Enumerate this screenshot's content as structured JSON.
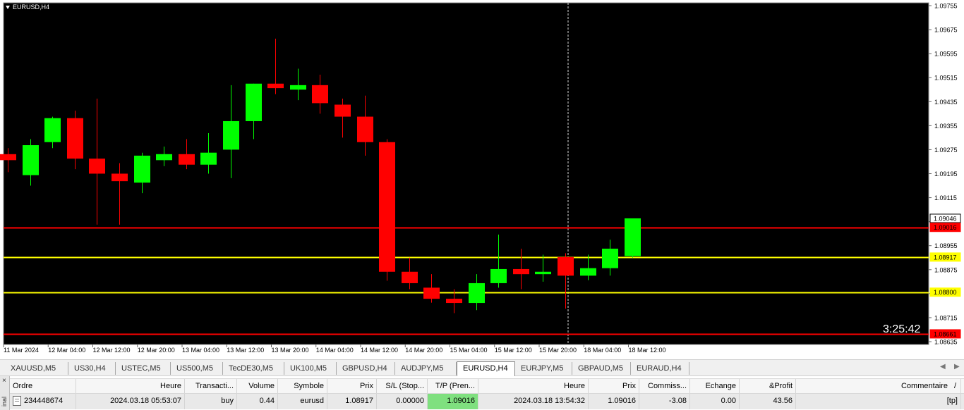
{
  "chart": {
    "symbol_label": "EURUSD,H4",
    "countdown": "3:25:42",
    "price_axis": [
      "1.09755",
      "1.09675",
      "1.09595",
      "1.09515",
      "1.09435",
      "1.09355",
      "1.09275",
      "1.09195",
      "1.09115",
      "1.09035",
      "1.08955",
      "1.08875",
      "1.08795",
      "1.08715",
      "1.08635"
    ],
    "price_tags": [
      {
        "price": "1.09046",
        "style": "current"
      },
      {
        "price": "1.09016",
        "style": "red"
      },
      {
        "price": "1.08917",
        "style": "yellow"
      },
      {
        "price": "1.08800",
        "style": "yellow"
      },
      {
        "price": "1.08661",
        "style": "red"
      }
    ],
    "time_axis": [
      "11 Mar 2024",
      "12 Mar 04:00",
      "12 Mar 12:00",
      "12 Mar 20:00",
      "13 Mar 04:00",
      "13 Mar 12:00",
      "13 Mar 20:00",
      "14 Mar 04:00",
      "14 Mar 12:00",
      "14 Mar 20:00",
      "15 Mar 04:00",
      "15 Mar 12:00",
      "15 Mar 20:00",
      "18 Mar 04:00",
      "18 Mar 12:00"
    ],
    "colors": {
      "background": "#000000",
      "bull": "#00ff00",
      "bear": "#ff0000",
      "tp_line": "#ff0000",
      "entry_line": "#ffff00"
    }
  },
  "chart_data": {
    "type": "candlestick",
    "title": "EURUSD,H4",
    "ylim": [
      1.08635,
      1.09755
    ],
    "horizontal_lines": [
      1.09016,
      1.08917,
      1.088,
      1.08661
    ],
    "candles": [
      {
        "o": 1.0926,
        "h": 1.0928,
        "l": 1.092,
        "c": 1.0924
      },
      {
        "o": 1.0919,
        "h": 1.0931,
        "l": 1.09155,
        "c": 1.0929
      },
      {
        "o": 1.093,
        "h": 1.09385,
        "l": 1.0928,
        "c": 1.0938
      },
      {
        "o": 1.0938,
        "h": 1.09405,
        "l": 1.0921,
        "c": 1.09245
      },
      {
        "o": 1.09245,
        "h": 1.09445,
        "l": 1.09025,
        "c": 1.09195
      },
      {
        "o": 1.09195,
        "h": 1.0923,
        "l": 1.09025,
        "c": 1.0917
      },
      {
        "o": 1.09165,
        "h": 1.09265,
        "l": 1.0913,
        "c": 1.09255
      },
      {
        "o": 1.0924,
        "h": 1.09285,
        "l": 1.0922,
        "c": 1.0926
      },
      {
        "o": 1.0926,
        "h": 1.0931,
        "l": 1.0921,
        "c": 1.09225
      },
      {
        "o": 1.09225,
        "h": 1.0933,
        "l": 1.09195,
        "c": 1.09265
      },
      {
        "o": 1.09275,
        "h": 1.0949,
        "l": 1.0918,
        "c": 1.0937
      },
      {
        "o": 1.0937,
        "h": 1.09495,
        "l": 1.0931,
        "c": 1.09495
      },
      {
        "o": 1.09495,
        "h": 1.09645,
        "l": 1.0946,
        "c": 1.0948
      },
      {
        "o": 1.09475,
        "h": 1.09545,
        "l": 1.0944,
        "c": 1.0949
      },
      {
        "o": 1.0949,
        "h": 1.09525,
        "l": 1.09395,
        "c": 1.0943
      },
      {
        "o": 1.09425,
        "h": 1.09445,
        "l": 1.09315,
        "c": 1.09385
      },
      {
        "o": 1.09385,
        "h": 1.09455,
        "l": 1.09255,
        "c": 1.093
      },
      {
        "o": 1.093,
        "h": 1.0931,
        "l": 1.08838,
        "c": 1.08868
      },
      {
        "o": 1.08868,
        "h": 1.08915,
        "l": 1.0881,
        "c": 1.0883
      },
      {
        "o": 1.08815,
        "h": 1.0886,
        "l": 1.08765,
        "c": 1.08778
      },
      {
        "o": 1.08778,
        "h": 1.0881,
        "l": 1.0873,
        "c": 1.08764
      },
      {
        "o": 1.08764,
        "h": 1.0886,
        "l": 1.0874,
        "c": 1.0883
      },
      {
        "o": 1.0883,
        "h": 1.08992,
        "l": 1.08815,
        "c": 1.08877
      },
      {
        "o": 1.08877,
        "h": 1.08945,
        "l": 1.0881,
        "c": 1.0886
      },
      {
        "o": 1.0886,
        "h": 1.08925,
        "l": 1.08835,
        "c": 1.08868
      },
      {
        "o": 1.08917,
        "h": 1.0893,
        "l": 1.08745,
        "c": 1.08855
      },
      {
        "o": 1.08855,
        "h": 1.08925,
        "l": 1.0884,
        "c": 1.0888
      },
      {
        "o": 1.0888,
        "h": 1.08975,
        "l": 1.08855,
        "c": 1.08945
      },
      {
        "o": 1.0892,
        "h": 1.09046,
        "l": 1.08915,
        "c": 1.09046
      }
    ]
  },
  "tabs": {
    "items": [
      "XAUUSD,M5",
      "US30,H4",
      "USTEC,M5",
      "US500,M5",
      "TecDE30,M5",
      "UK100,M5",
      "GBPUSD,H4",
      "AUDJPY,M5",
      "EURUSD,H4",
      "EURJPY,M5",
      "GBPAUD,M5",
      "EURAUD,H4"
    ],
    "active": "EURUSD,H4",
    "arrow_left": "◀",
    "arrow_right": "▶"
  },
  "terminal": {
    "side_label": "inal",
    "close_glyph": "×",
    "headers": [
      "Ordre",
      "Heure",
      "Transacti...",
      "Volume",
      "Symbole",
      "Prix",
      "S/L (Stop...",
      "T/P (Pren...",
      "Heure",
      "Prix",
      "Commiss...",
      "Echange",
      "&Profit",
      "Commentaire"
    ],
    "sort_glyph": "/",
    "row": [
      "234448674",
      "2024.03.18 05:53:07",
      "buy",
      "0.44",
      "eurusd",
      "1.08917",
      "0.00000",
      "1.09016",
      "2024.03.18 13:54:32",
      "1.09016",
      "-3.08",
      "0.00",
      "43.56",
      "[tp]"
    ]
  }
}
